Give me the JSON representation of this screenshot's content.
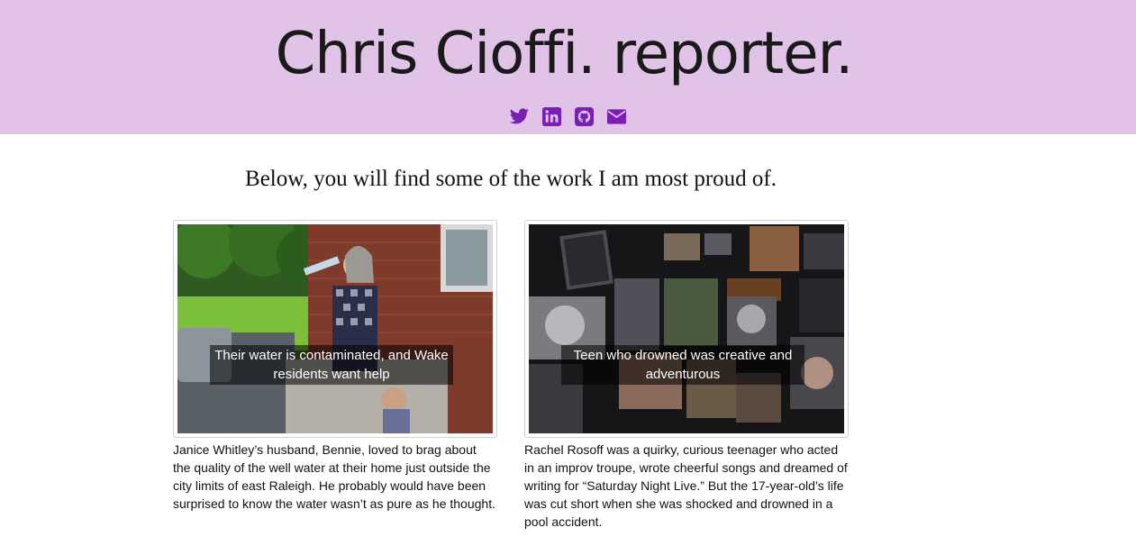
{
  "header": {
    "title": "Chris Cioffi. reporter.",
    "socials": [
      {
        "icon": "twitter-icon"
      },
      {
        "icon": "linkedin-icon"
      },
      {
        "icon": "github-icon"
      },
      {
        "icon": "envelope-icon"
      }
    ],
    "accent": "#7a1fb5",
    "background": "#e0c3e6"
  },
  "intro": "Below, you will find some of the work I am most proud of.",
  "stories": [
    {
      "caption": "Their water is contaminated, and Wake residents want help",
      "blurb": "Janice Whitley’s husband, Bennie, loved to brag about the quality of the well water at their home just outside the city limits of east Raleigh. He probably would have been surprised to know the water wasn’t as pure as he thought."
    },
    {
      "caption": "Teen who drowned was creative and adventurous",
      "blurb": "Rachel Rosoff was a quirky, curious teenager who acted in an improv troupe, wrote cheerful songs and dreamed of writing for “Saturday Night Live.” But the 17-year-old’s life was cut short when she was shocked and drowned in a pool accident."
    }
  ]
}
